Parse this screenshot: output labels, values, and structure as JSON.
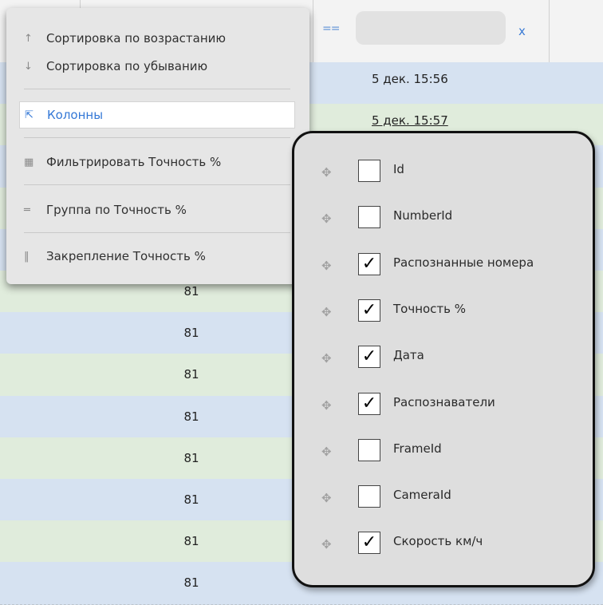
{
  "grid": {
    "filter": {
      "operator": "==",
      "value": "",
      "clear_label": "x"
    },
    "rows": [
      {
        "accuracy": "",
        "date": "5 дек. 15:56",
        "style": "blue"
      },
      {
        "accuracy": "",
        "date": "5 дек. 15:57",
        "style": "green"
      },
      {
        "accuracy": "",
        "date": "",
        "style": "blue"
      },
      {
        "accuracy": "",
        "date": "",
        "style": "green"
      },
      {
        "accuracy": "",
        "date": "",
        "style": "blue"
      },
      {
        "accuracy": "81",
        "date": "",
        "style": "green"
      },
      {
        "accuracy": "81",
        "date": "",
        "style": "blue"
      },
      {
        "accuracy": "81",
        "date": "",
        "style": "green"
      },
      {
        "accuracy": "81",
        "date": "",
        "style": "blue"
      },
      {
        "accuracy": "81",
        "date": "",
        "style": "green"
      },
      {
        "accuracy": "81",
        "date": "",
        "style": "blue"
      },
      {
        "accuracy": "81",
        "date": "",
        "style": "green"
      },
      {
        "accuracy": "81",
        "date": "",
        "style": "blue"
      }
    ]
  },
  "context_menu": {
    "items": [
      {
        "icon": "sort-ascending-icon",
        "glyph": "↑",
        "label": "Сортировка по возрастанию"
      },
      {
        "icon": "sort-descending-icon",
        "glyph": "↓",
        "label": "Сортировка по убыванию"
      },
      {
        "icon": "external-link-icon",
        "glyph": "⇱",
        "label": "Колонны"
      },
      {
        "icon": "filter-grid-icon",
        "glyph": "▦",
        "label": "Фильтрировать Точность %"
      },
      {
        "icon": "group-icon",
        "glyph": "═",
        "label": "Группа по Точность %"
      },
      {
        "icon": "pin-icon",
        "glyph": "‖",
        "label": "Закрепление Точность %"
      }
    ]
  },
  "columns_popup": {
    "columns": [
      {
        "label": "Id",
        "checked": false
      },
      {
        "label": "NumberId",
        "checked": false
      },
      {
        "label": "Распознанные номера",
        "checked": true
      },
      {
        "label": "Точность %",
        "checked": true
      },
      {
        "label": "Дата",
        "checked": true
      },
      {
        "label": "Распознаватели",
        "checked": true
      },
      {
        "label": "FrameId",
        "checked": false
      },
      {
        "label": "CameraId",
        "checked": false
      },
      {
        "label": "Скорость км/ч",
        "checked": true
      }
    ]
  }
}
